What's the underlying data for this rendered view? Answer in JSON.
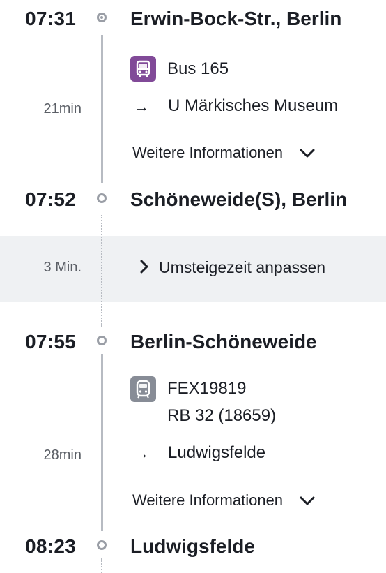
{
  "segments": [
    {
      "dep_time": "07:31",
      "dep_station": "Erwin-Bock-Str., Berlin",
      "vehicle_icon": "bus-icon",
      "line": "Bus 165",
      "duration": "21min",
      "destination_arrow": "→",
      "destination": "U Märkisches Museum",
      "more_info": "Weitere Informationen",
      "arr_time": "07:52",
      "arr_station": "Schöneweide(S), Berlin",
      "badge_color": "#814a98"
    },
    {
      "dep_time": "07:55",
      "dep_station": "Berlin-Schöneweide",
      "vehicle_icon": "train-icon",
      "line": "FEX19819",
      "line_sub": "RB 32 (18659)",
      "duration": "28min",
      "destination_arrow": "→",
      "destination": "Ludwigsfelde",
      "more_info": "Weitere Informationen",
      "arr_time": "08:23",
      "arr_station": "Ludwigsfelde",
      "badge_color": "#878c96"
    }
  ],
  "transfer": {
    "duration": "3 Min.",
    "label": "Umsteigezeit anpassen"
  },
  "colors": {
    "timeline": "#b7bbc2",
    "transfer_bg": "#eff1f3",
    "text": "#1b1e25",
    "muted": "#5b5f66"
  }
}
